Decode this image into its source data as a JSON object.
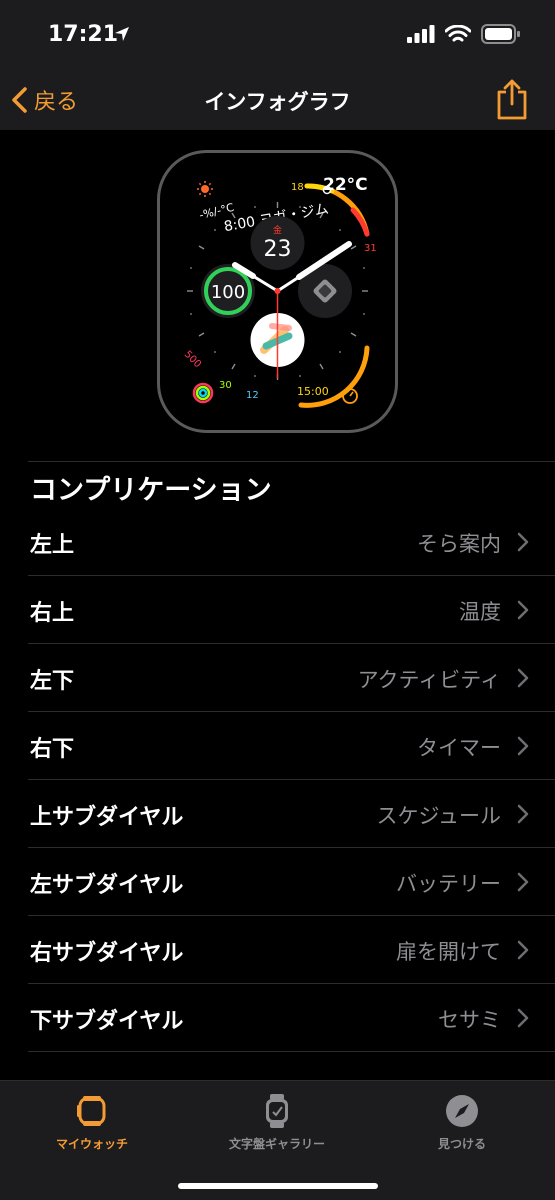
{
  "status_bar": {
    "time": "17:21"
  },
  "nav": {
    "back_label": "戻る",
    "title": "インフォグラフ"
  },
  "watch_face": {
    "temp_small": "-%/-°C",
    "temp_value": "22°C",
    "temp_min": "18",
    "temp_max": "31",
    "event": "8:00 ヨガ・ジム",
    "weekday": "金",
    "day": "23",
    "battery": "100",
    "activity_move": "500",
    "activity_exercise": "30",
    "activity_stand": "12",
    "timer": "15:00"
  },
  "section_header": "コンプリケーション",
  "complications": [
    {
      "label": "左上",
      "value": "そら案内"
    },
    {
      "label": "右上",
      "value": "温度"
    },
    {
      "label": "左下",
      "value": "アクティビティ"
    },
    {
      "label": "右下",
      "value": "タイマー"
    },
    {
      "label": "上サブダイヤル",
      "value": "スケジュール"
    },
    {
      "label": "左サブダイヤル",
      "value": "バッテリー"
    },
    {
      "label": "右サブダイヤル",
      "value": "扉を開けて"
    },
    {
      "label": "下サブダイヤル",
      "value": "セサミ"
    }
  ],
  "tabs": [
    {
      "label": "マイウォッチ",
      "active": true
    },
    {
      "label": "文字盤ギャラリー",
      "active": false
    },
    {
      "label": "見つける",
      "active": false
    }
  ],
  "colors": {
    "accent": "#f39c33",
    "secondary_text": "#8e8e93",
    "bar_bg": "#1c1c1e"
  }
}
